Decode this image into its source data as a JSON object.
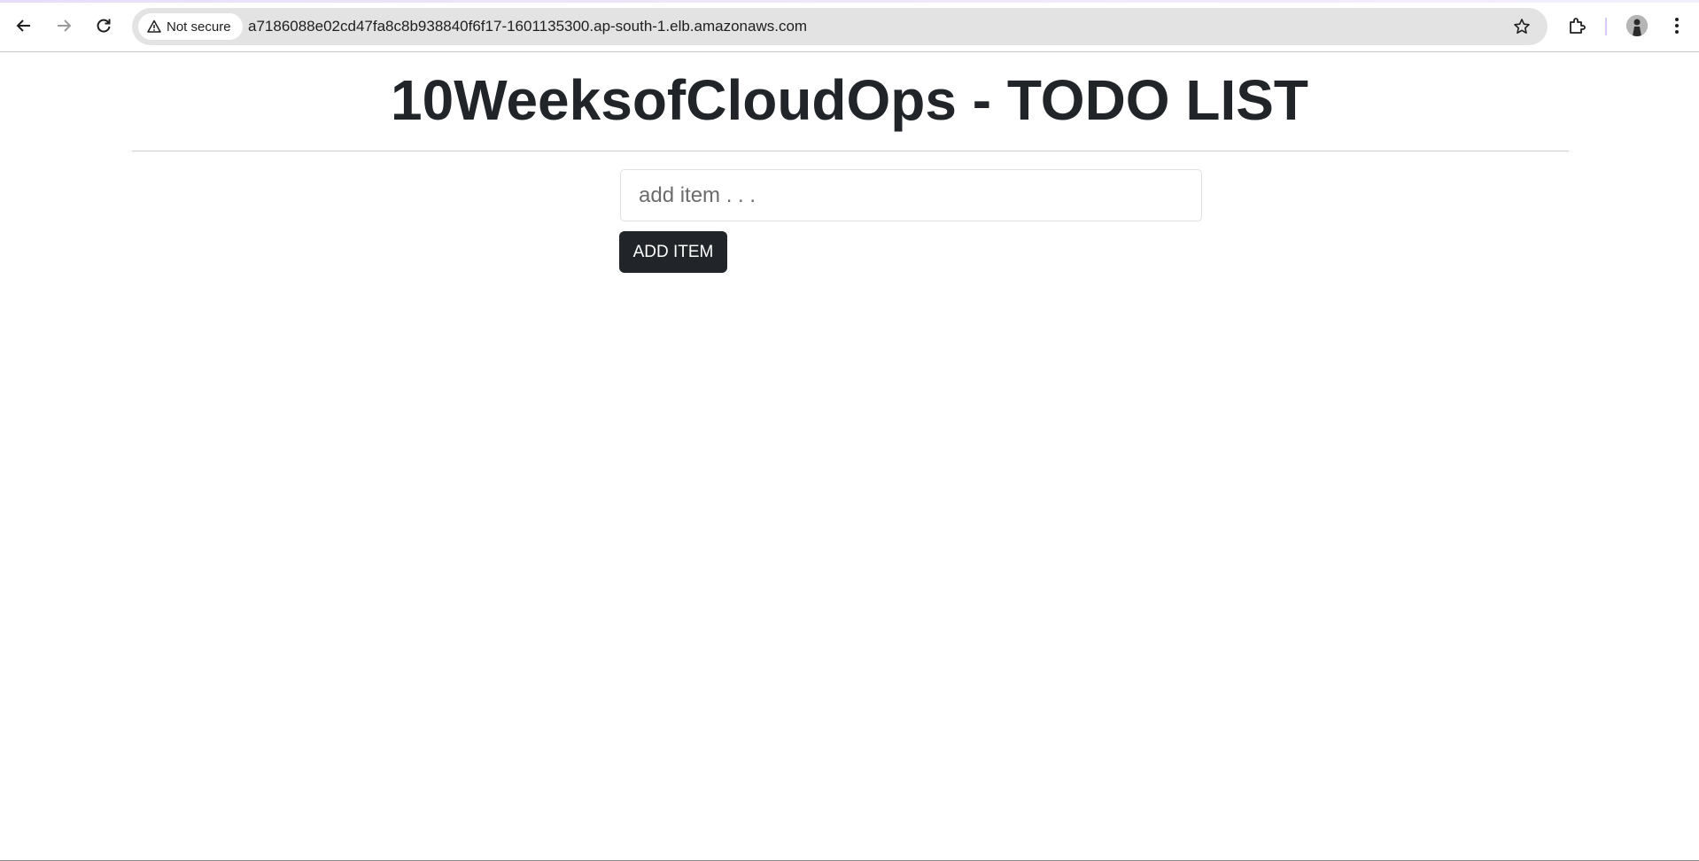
{
  "browser": {
    "security_label": "Not secure",
    "url": "a7186088e02cd47fa8c8b938840f6f17-1601135300.ap-south-1.elb.amazonaws.com",
    "icons": {
      "back": "arrow-left-icon",
      "forward": "arrow-right-icon",
      "reload": "reload-icon",
      "security": "warning-triangle-icon",
      "bookmark": "star-icon",
      "extensions": "puzzle-icon",
      "profile": "avatar",
      "menu": "kebab-menu-icon"
    }
  },
  "page": {
    "title": "10WeeksofCloudOps - TODO LIST",
    "input": {
      "placeholder": "add item . . .",
      "value": ""
    },
    "add_button_label": "ADD ITEM"
  },
  "colors": {
    "button_bg": "#212529",
    "title_text": "#212529",
    "omnibox_bg": "#e3e3e3"
  }
}
